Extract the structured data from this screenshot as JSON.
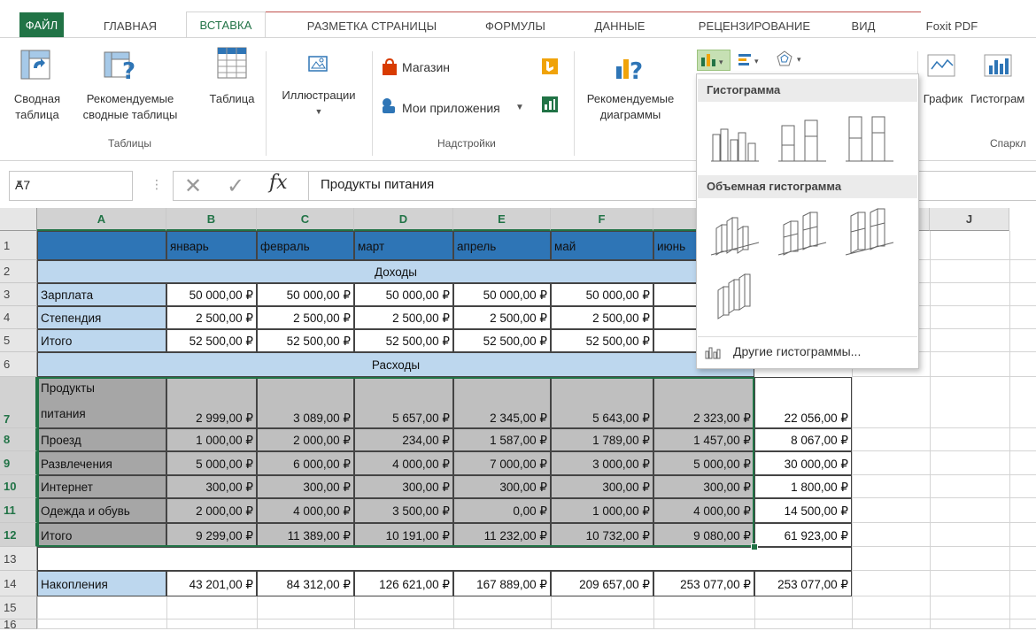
{
  "tabs": [
    "ФАЙЛ",
    "ГЛАВНАЯ",
    "ВСТАВКА",
    "РАЗМЕТКА СТРАНИЦЫ",
    "ФОРМУЛЫ",
    "ДАННЫЕ",
    "РЕЦЕНЗИРОВАНИЕ",
    "ВИД",
    "Foxit PDF"
  ],
  "ribbon": {
    "pivot_line1": "Сводная",
    "pivot_line2": "таблица",
    "recpivot_line1": "Рекомендуемые",
    "recpivot_line2": "сводные таблицы",
    "table": "Таблица",
    "illustrations": "Иллюстрации",
    "store": "Магазин",
    "myapps": "Мои приложения",
    "recchart_line1": "Рекомендуемые",
    "recchart_line2": "диаграммы",
    "line": "График",
    "column": "Гистограм",
    "groups": {
      "tables": "Таблицы",
      "addins": "Надстройки",
      "sparklines": "Спаркл"
    }
  },
  "formula": {
    "cell_ref": "A7",
    "fx": "fx",
    "value": "Продукты питания"
  },
  "colors": {
    "accent": "#217346",
    "header_blue": "#2e75b6",
    "light_blue": "#bdd7ee",
    "selection_gray": "#bfbfbf",
    "label_gray": "#a6a6a6"
  },
  "columns": [
    "A",
    "B",
    "C",
    "D",
    "E",
    "F",
    "G",
    "H",
    "I",
    "J"
  ],
  "rows": [
    "1",
    "2",
    "3",
    "4",
    "5",
    "6",
    "7",
    "8",
    "9",
    "10",
    "11",
    "12",
    "13",
    "14",
    "15",
    "16"
  ],
  "sheet": {
    "months": [
      "январь",
      "февраль",
      "март",
      "апрель",
      "май",
      "июнь"
    ],
    "income_title": "Доходы",
    "expense_title": "Расходы",
    "income": [
      {
        "label": "Зарплата",
        "values": [
          "50 000,00 ₽",
          "50 000,00 ₽",
          "50 000,00 ₽",
          "50 000,00 ₽",
          "50 000,00 ₽",
          "50 0"
        ]
      },
      {
        "label": "Степендия",
        "values": [
          "2 500,00 ₽",
          "2 500,00 ₽",
          "2 500,00 ₽",
          "2 500,00 ₽",
          "2 500,00 ₽",
          "2 5"
        ]
      },
      {
        "label": "Итого",
        "values": [
          "52 500,00 ₽",
          "52 500,00 ₽",
          "52 500,00 ₽",
          "52 500,00 ₽",
          "52 500,00 ₽",
          "52 5"
        ]
      }
    ],
    "expenses": [
      {
        "label1": "Продукты",
        "label2": "питания",
        "values": [
          "2 999,00 ₽",
          "3 089,00 ₽",
          "5 657,00 ₽",
          "2 345,00 ₽",
          "5 643,00 ₽",
          "2 323,00 ₽"
        ],
        "total": "22 056,00 ₽"
      },
      {
        "label1": "Проезд",
        "label2": "",
        "values": [
          "1 000,00 ₽",
          "2 000,00 ₽",
          "234,00 ₽",
          "1 587,00 ₽",
          "1 789,00 ₽",
          "1 457,00 ₽"
        ],
        "total": "8 067,00 ₽"
      },
      {
        "label1": "Развлечения",
        "label2": "",
        "values": [
          "5 000,00 ₽",
          "6 000,00 ₽",
          "4 000,00 ₽",
          "7 000,00 ₽",
          "3 000,00 ₽",
          "5 000,00 ₽"
        ],
        "total": "30 000,00 ₽"
      },
      {
        "label1": "Интернет",
        "label2": "",
        "values": [
          "300,00 ₽",
          "300,00 ₽",
          "300,00 ₽",
          "300,00 ₽",
          "300,00 ₽",
          "300,00 ₽"
        ],
        "total": "1 800,00 ₽"
      },
      {
        "label1": "Одежда и обувь",
        "label2": "",
        "values": [
          "2 000,00 ₽",
          "4 000,00 ₽",
          "3 500,00 ₽",
          "0,00 ₽",
          "1 000,00 ₽",
          "4 000,00 ₽"
        ],
        "total": "14 500,00 ₽"
      },
      {
        "label1": "Итого",
        "label2": "",
        "values": [
          "9 299,00 ₽",
          "11 389,00 ₽",
          "10 191,00 ₽",
          "11 232,00 ₽",
          "10 732,00 ₽",
          "9 080,00 ₽"
        ],
        "total": "61 923,00 ₽"
      }
    ],
    "savings": {
      "label": "Накопления",
      "values": [
        "43 201,00 ₽",
        "84 312,00 ₽",
        "126 621,00 ₽",
        "167 889,00 ₽",
        "209 657,00 ₽",
        "253 077,00 ₽"
      ],
      "total": "253 077,00 ₽"
    }
  },
  "dropdown": {
    "section1": "Гистограмма",
    "section2": "Объемная гистограмма",
    "more": "Другие гистограммы..."
  }
}
